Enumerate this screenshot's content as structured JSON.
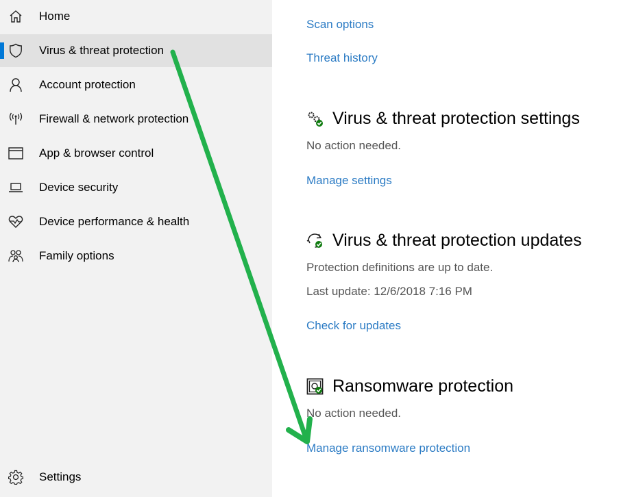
{
  "sidebar": {
    "items": [
      {
        "label": "Home",
        "icon": "home-icon"
      },
      {
        "label": "Virus & threat protection",
        "icon": "shield-icon",
        "selected": true
      },
      {
        "label": "Account protection",
        "icon": "person-icon"
      },
      {
        "label": "Firewall & network protection",
        "icon": "wireless-antenna-icon"
      },
      {
        "label": "App & browser control",
        "icon": "browser-window-icon"
      },
      {
        "label": "Device security",
        "icon": "laptop-icon"
      },
      {
        "label": "Device performance & health",
        "icon": "heart-pulse-icon"
      },
      {
        "label": "Family options",
        "icon": "family-icon"
      }
    ],
    "settings": {
      "label": "Settings",
      "icon": "gear-icon"
    }
  },
  "main": {
    "scan_options": "Scan options",
    "threat_history": "Threat history",
    "settings_section": {
      "title": "Virus & threat protection settings",
      "status": "No action needed.",
      "link": "Manage settings"
    },
    "updates_section": {
      "title": "Virus & threat protection updates",
      "status": "Protection definitions are up to date.",
      "last_update": "Last update: 12/6/2018 7:16 PM",
      "link": "Check for updates"
    },
    "ransomware_section": {
      "title": "Ransomware protection",
      "status": "No action needed.",
      "link": "Manage ransomware protection"
    }
  },
  "colors": {
    "accent": "#0078d7",
    "link": "#2b7bc4",
    "annotation_arrow": "#22b14c",
    "status_ok": "#107c10"
  }
}
